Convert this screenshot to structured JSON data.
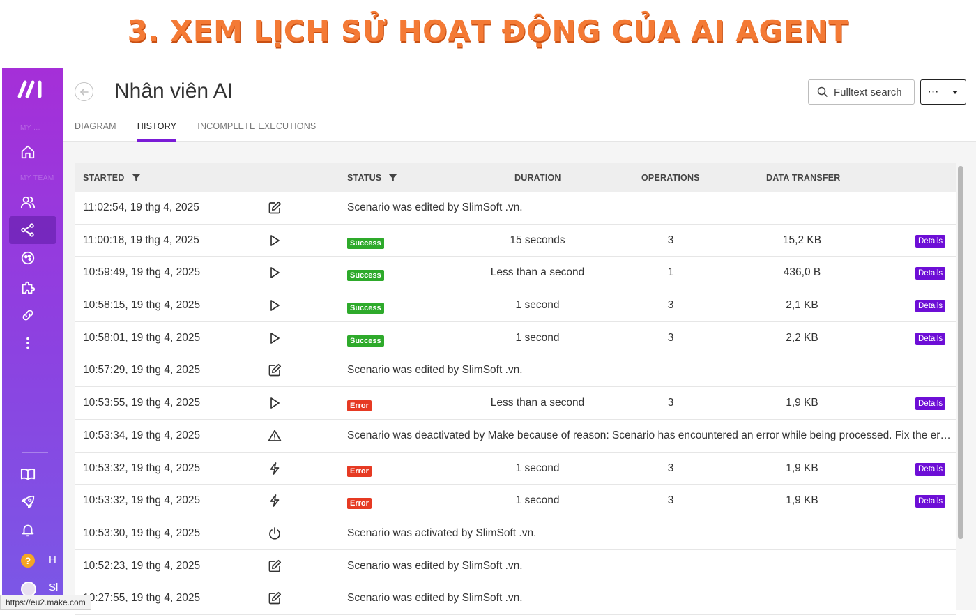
{
  "banner": {
    "title": "3. XEM LỊCH SỬ HOẠT ĐỘNG CỦA AI AGENT"
  },
  "sidebar": {
    "org_label": "MY ...",
    "team_label": "MY TEAM",
    "help_letter": "H",
    "user_letter": "Sl",
    "items": [
      {
        "icon": "home-icon"
      },
      {
        "icon": "team-icon"
      },
      {
        "icon": "scenarios-icon",
        "active": true
      },
      {
        "icon": "templates-icon"
      },
      {
        "icon": "apps-icon"
      },
      {
        "icon": "connections-icon"
      },
      {
        "icon": "more-vertical-icon"
      },
      {
        "icon": "book-icon"
      },
      {
        "icon": "rocket-icon"
      },
      {
        "icon": "bell-icon"
      },
      {
        "icon": "help-icon"
      },
      {
        "icon": "avatar"
      }
    ]
  },
  "header": {
    "title": "Nhân viên AI",
    "tabs": [
      "DIAGRAM",
      "HISTORY",
      "INCOMPLETE EXECUTIONS"
    ],
    "active_tab": "HISTORY",
    "search_label": "Fulltext search",
    "more_label": "···"
  },
  "table": {
    "columns": {
      "started": "STARTED",
      "status": "STATUS",
      "duration": "DURATION",
      "operations": "OPERATIONS",
      "data_transfer": "DATA TRANSFER"
    },
    "details_label": "Details",
    "rows": [
      {
        "started": "11:02:54, 19 thg 4, 2025",
        "icon": "edit-icon",
        "message": "Scenario was edited by SlimSoft .vn."
      },
      {
        "started": "11:00:18, 19 thg 4, 2025",
        "icon": "play-icon",
        "status": "Success",
        "duration": "15 seconds",
        "operations": "3",
        "data": "15,2 KB"
      },
      {
        "started": "10:59:49, 19 thg 4, 2025",
        "icon": "play-icon",
        "status": "Success",
        "duration": "Less than a second",
        "operations": "1",
        "data": "436,0 B"
      },
      {
        "started": "10:58:15, 19 thg 4, 2025",
        "icon": "play-icon",
        "status": "Success",
        "duration": "1 second",
        "operations": "3",
        "data": "2,1 KB"
      },
      {
        "started": "10:58:01, 19 thg 4, 2025",
        "icon": "play-icon",
        "status": "Success",
        "duration": "1 second",
        "operations": "3",
        "data": "2,2 KB"
      },
      {
        "started": "10:57:29, 19 thg 4, 2025",
        "icon": "edit-icon",
        "message": "Scenario was edited by SlimSoft .vn."
      },
      {
        "started": "10:53:55, 19 thg 4, 2025",
        "icon": "play-icon",
        "status": "Error",
        "duration": "Less than a second",
        "operations": "3",
        "data": "1,9 KB"
      },
      {
        "started": "10:53:34, 19 thg 4, 2025",
        "icon": "warning-icon",
        "message": "Scenario was deactivated by Make because of reason: Scenario has encountered an error while being processed. Fix the error and activate the scenario again."
      },
      {
        "started": "10:53:32, 19 thg 4, 2025",
        "icon": "lightning-icon",
        "status": "Error",
        "duration": "1 second",
        "operations": "3",
        "data": "1,9 KB"
      },
      {
        "started": "10:53:32, 19 thg 4, 2025",
        "icon": "lightning-icon",
        "status": "Error",
        "duration": "1 second",
        "operations": "3",
        "data": "1,9 KB"
      },
      {
        "started": "10:53:30, 19 thg 4, 2025",
        "icon": "power-icon",
        "message": "Scenario was activated by SlimSoft .vn."
      },
      {
        "started": "10:52:23, 19 thg 4, 2025",
        "icon": "edit-icon",
        "message": "Scenario was edited by SlimSoft .vn."
      },
      {
        "started": "10:27:55, 19 thg 4, 2025",
        "icon": "edit-icon",
        "message": "Scenario was edited by SlimSoft .vn."
      }
    ]
  },
  "statusbar": {
    "url": "https://eu2.make.com"
  },
  "colors": {
    "accent": "#6d0ed6",
    "success": "#2eaa2b",
    "error": "#e63a23",
    "banner": "#f47a35"
  }
}
